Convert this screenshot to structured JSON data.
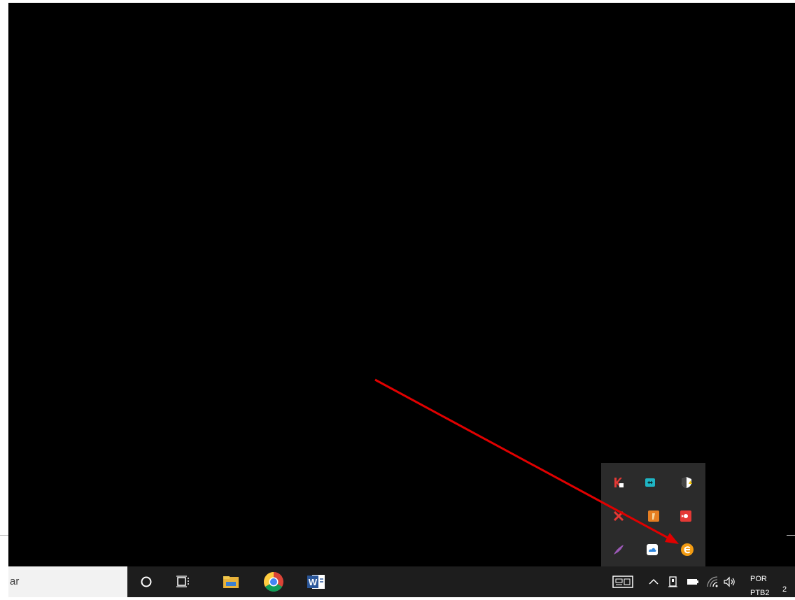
{
  "taskbar": {
    "search_text": "ar",
    "language_line1": "POR",
    "language_line2": "PTB2",
    "clock_fragment": "2"
  },
  "tray_overflow_icons": [
    {
      "name": "kaspersky-icon",
      "color": "#e53935"
    },
    {
      "name": "teamviewer-style-icon",
      "color": "#1fb5c4"
    },
    {
      "name": "security-shield-icon",
      "color": "#ffffff"
    },
    {
      "name": "red-x-icon",
      "color": "#e53935"
    },
    {
      "name": "orange-app-icon",
      "color": "#e67e22"
    },
    {
      "name": "red-app-icon",
      "color": "#e53935"
    },
    {
      "name": "feather-icon",
      "color": "#9b59b6"
    },
    {
      "name": "onedrive-cloud-icon",
      "color": "#ffffff"
    },
    {
      "name": "orange-e-icon",
      "color": "#f39c12"
    }
  ],
  "colors": {
    "desktop": "#000000",
    "taskbar": "#1d1d1d",
    "arrow": "#e00000"
  }
}
